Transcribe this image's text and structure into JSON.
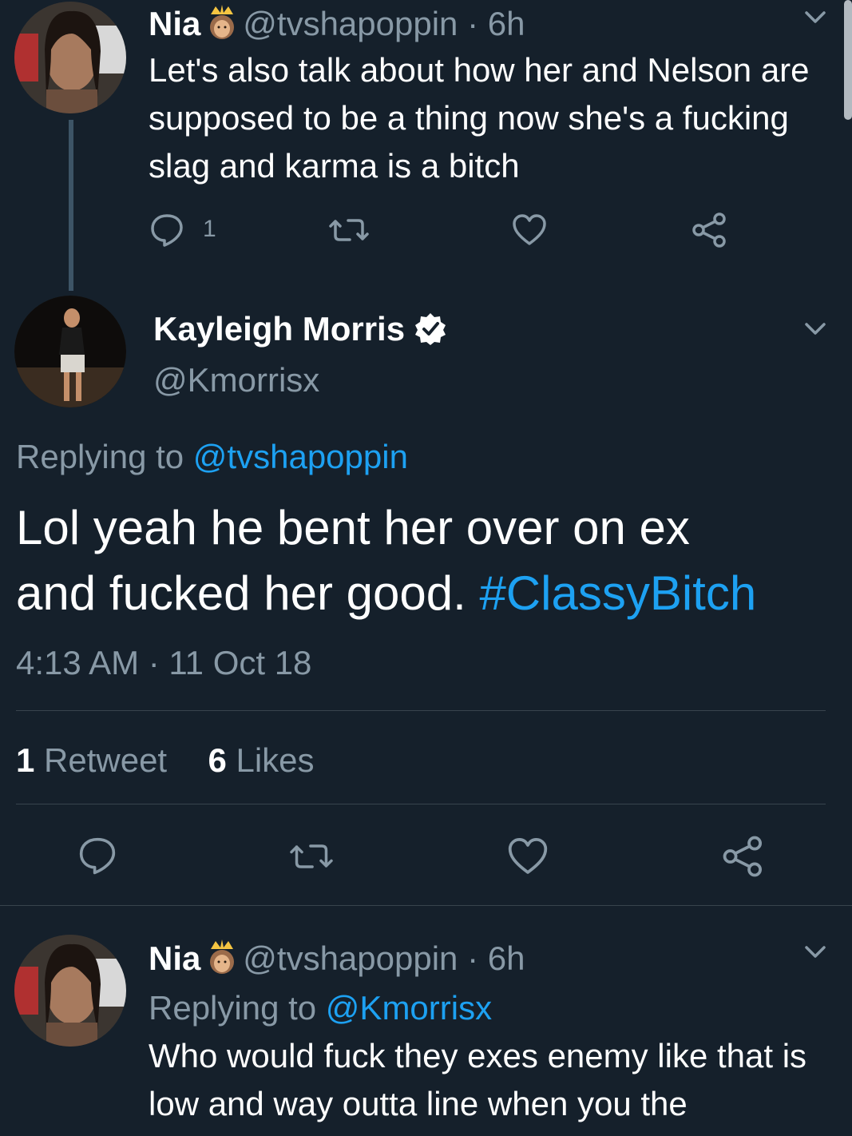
{
  "tweet1": {
    "name": "Nia",
    "handle_time": "@tvshapoppin · 6h",
    "text": "Let's also talk about how her and Nelson are supposed to be a thing now she's a fucking slag and karma is a bitch",
    "reply_count": "1",
    "icons": [
      "reply-icon",
      "retweet-icon",
      "like-icon",
      "share-icon",
      "chevron-down-icon",
      "crown-emoji-icon"
    ]
  },
  "main": {
    "name": "Kayleigh Morris",
    "handle": "@Kmorrisx",
    "replying_prefix": "Replying to ",
    "replying_to": "@tvshapoppin",
    "text_1": "Lol yeah he bent her over on ex",
    "text_2": "and fucked her good. ",
    "hashtag": "#ClassyBitch",
    "timestamp": "4:13 AM · 11 Oct 18",
    "retweets_num": "1",
    "retweets_label": " Retweet",
    "likes_num": "6",
    "likes_label": " Likes",
    "icons": [
      "verified-badge-icon",
      "reply-icon",
      "retweet-icon",
      "like-icon",
      "share-icon",
      "chevron-down-icon"
    ]
  },
  "tweet3": {
    "name": "Nia",
    "handle_time": "@tvshapoppin · 6h",
    "replying_prefix": "Replying to ",
    "replying_to": "@Kmorrisx",
    "text": "Who would fuck they exes enemy like that is low and way outta line when you the"
  },
  "colors": {
    "background": "#15202b",
    "link": "#1da1f2",
    "muted": "#8899a6",
    "divider": "#38444d"
  }
}
